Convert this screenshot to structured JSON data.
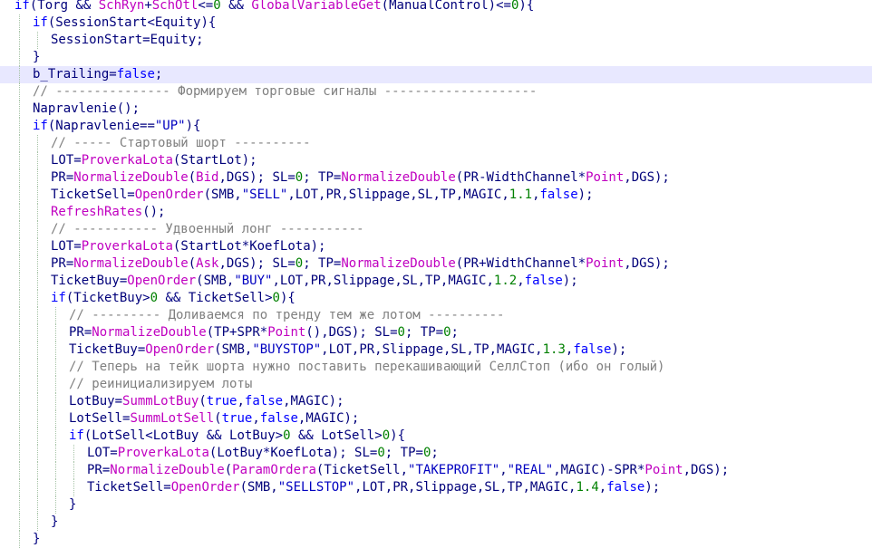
{
  "editor": {
    "colors": {
      "keyword": "#0000ff",
      "identifier": "#00007a",
      "function": "#c000c0",
      "string": "#0000c0",
      "number": "#008000",
      "comment": "#808080",
      "current_line": "#e8e8ff",
      "background": "#ffffff"
    },
    "lines": [
      {
        "indent": 0,
        "tokens": [
          [
            "kw",
            "if"
          ],
          [
            "id",
            "(Torg "
          ],
          [
            "op",
            "&& "
          ],
          [
            "fn",
            "SchRyn"
          ],
          [
            "op",
            "+"
          ],
          [
            "fn",
            "SchOtl"
          ],
          [
            "op",
            "<="
          ],
          [
            "num",
            "0"
          ],
          [
            "id",
            " "
          ],
          [
            "op",
            "&& "
          ],
          [
            "fn",
            "GlobalVariableGet"
          ],
          [
            "id",
            "(ManualControl)"
          ],
          [
            "op",
            "<="
          ],
          [
            "num",
            "0"
          ],
          [
            "id",
            ")"
          ],
          [
            "op",
            "{"
          ]
        ]
      },
      {
        "indent": 1,
        "tokens": [
          [
            "kw",
            "if"
          ],
          [
            "id",
            "(SessionStart"
          ],
          [
            "op",
            "<"
          ],
          [
            "id",
            "Equity)"
          ],
          [
            "op",
            "{"
          ]
        ]
      },
      {
        "indent": 2,
        "tokens": [
          [
            "id",
            "SessionStart"
          ],
          [
            "op",
            "="
          ],
          [
            "id",
            "Equity;"
          ]
        ]
      },
      {
        "indent": 1,
        "tokens": [
          [
            "op",
            "}"
          ]
        ]
      },
      {
        "indent": 1,
        "highlight": true,
        "tokens": [
          [
            "id",
            "b_Trailing"
          ],
          [
            "op",
            "="
          ],
          [
            "kw",
            "false"
          ],
          [
            "id",
            ";"
          ]
        ]
      },
      {
        "indent": 1,
        "tokens": [
          [
            "cm",
            "// --------------- Формируем торговые сигналы --------------------"
          ]
        ]
      },
      {
        "indent": 1,
        "tokens": [
          [
            "id",
            "Napravlenie();"
          ]
        ]
      },
      {
        "indent": 1,
        "tokens": [
          [
            "kw",
            "if"
          ],
          [
            "id",
            "(Napravlenie"
          ],
          [
            "op",
            "=="
          ],
          [
            "str",
            "\"UP\""
          ],
          [
            "id",
            ")"
          ],
          [
            "op",
            "{"
          ]
        ]
      },
      {
        "indent": 2,
        "tokens": [
          [
            "cm",
            "// ----- Стартовый шорт ----------"
          ]
        ]
      },
      {
        "indent": 2,
        "tokens": [
          [
            "id",
            "LOT"
          ],
          [
            "op",
            "="
          ],
          [
            "fn",
            "ProverkaLota"
          ],
          [
            "id",
            "(StartLot);"
          ]
        ]
      },
      {
        "indent": 2,
        "tokens": [
          [
            "id",
            "PR"
          ],
          [
            "op",
            "="
          ],
          [
            "fn",
            "NormalizeDouble"
          ],
          [
            "id",
            "("
          ],
          [
            "fn",
            "Bid"
          ],
          [
            "id",
            ",DGS); SL"
          ],
          [
            "op",
            "="
          ],
          [
            "num",
            "0"
          ],
          [
            "id",
            "; TP"
          ],
          [
            "op",
            "="
          ],
          [
            "fn",
            "NormalizeDouble"
          ],
          [
            "id",
            "(PR"
          ],
          [
            "op",
            "-"
          ],
          [
            "id",
            "WidthChannel"
          ],
          [
            "op",
            "*"
          ],
          [
            "fn",
            "Point"
          ],
          [
            "id",
            ",DGS);"
          ]
        ]
      },
      {
        "indent": 2,
        "tokens": [
          [
            "id",
            "TicketSell"
          ],
          [
            "op",
            "="
          ],
          [
            "fn",
            "OpenOrder"
          ],
          [
            "id",
            "(SMB,"
          ],
          [
            "str",
            "\"SELL\""
          ],
          [
            "id",
            ",LOT,PR,Slippage,SL,TP,MAGIC,"
          ],
          [
            "num",
            "1.1"
          ],
          [
            "id",
            ","
          ],
          [
            "kw",
            "false"
          ],
          [
            "id",
            ");"
          ]
        ]
      },
      {
        "indent": 2,
        "tokens": [
          [
            "fn",
            "RefreshRates"
          ],
          [
            "id",
            "();"
          ]
        ]
      },
      {
        "indent": 2,
        "tokens": [
          [
            "cm",
            "// ----------- Удвоенный лонг -----------"
          ]
        ]
      },
      {
        "indent": 2,
        "tokens": [
          [
            "id",
            "LOT"
          ],
          [
            "op",
            "="
          ],
          [
            "fn",
            "ProverkaLota"
          ],
          [
            "id",
            "(StartLot"
          ],
          [
            "op",
            "*"
          ],
          [
            "id",
            "KoefLota);"
          ]
        ]
      },
      {
        "indent": 2,
        "tokens": [
          [
            "id",
            "PR"
          ],
          [
            "op",
            "="
          ],
          [
            "fn",
            "NormalizeDouble"
          ],
          [
            "id",
            "("
          ],
          [
            "fn",
            "Ask"
          ],
          [
            "id",
            ",DGS); SL"
          ],
          [
            "op",
            "="
          ],
          [
            "num",
            "0"
          ],
          [
            "id",
            "; TP"
          ],
          [
            "op",
            "="
          ],
          [
            "fn",
            "NormalizeDouble"
          ],
          [
            "id",
            "(PR"
          ],
          [
            "op",
            "+"
          ],
          [
            "id",
            "WidthChannel"
          ],
          [
            "op",
            "*"
          ],
          [
            "fn",
            "Point"
          ],
          [
            "id",
            ",DGS);"
          ]
        ]
      },
      {
        "indent": 2,
        "tokens": [
          [
            "id",
            "TicketBuy"
          ],
          [
            "op",
            "="
          ],
          [
            "fn",
            "OpenOrder"
          ],
          [
            "id",
            "(SMB,"
          ],
          [
            "str",
            "\"BUY\""
          ],
          [
            "id",
            ",LOT,PR,Slippage,SL,TP,MAGIC,"
          ],
          [
            "num",
            "1.2"
          ],
          [
            "id",
            ","
          ],
          [
            "kw",
            "false"
          ],
          [
            "id",
            ");"
          ]
        ]
      },
      {
        "indent": 2,
        "tokens": [
          [
            "kw",
            "if"
          ],
          [
            "id",
            "(TicketBuy"
          ],
          [
            "op",
            ">"
          ],
          [
            "num",
            "0"
          ],
          [
            "id",
            " "
          ],
          [
            "op",
            "&& "
          ],
          [
            "id",
            "TicketSell"
          ],
          [
            "op",
            ">"
          ],
          [
            "num",
            "0"
          ],
          [
            "id",
            ")"
          ],
          [
            "op",
            "{"
          ]
        ]
      },
      {
        "indent": 3,
        "tokens": [
          [
            "cm",
            "// --------- Доливаемся по тренду тем же лотом ----------"
          ]
        ]
      },
      {
        "indent": 3,
        "tokens": [
          [
            "id",
            "PR"
          ],
          [
            "op",
            "="
          ],
          [
            "fn",
            "NormalizeDouble"
          ],
          [
            "id",
            "(TP"
          ],
          [
            "op",
            "+"
          ],
          [
            "id",
            "SPR"
          ],
          [
            "op",
            "*"
          ],
          [
            "fn",
            "Point"
          ],
          [
            "id",
            "(),DGS); SL"
          ],
          [
            "op",
            "="
          ],
          [
            "num",
            "0"
          ],
          [
            "id",
            "; TP"
          ],
          [
            "op",
            "="
          ],
          [
            "num",
            "0"
          ],
          [
            "id",
            ";"
          ]
        ]
      },
      {
        "indent": 3,
        "tokens": [
          [
            "id",
            "TicketBuy"
          ],
          [
            "op",
            "="
          ],
          [
            "fn",
            "OpenOrder"
          ],
          [
            "id",
            "(SMB,"
          ],
          [
            "str",
            "\"BUYSTOP\""
          ],
          [
            "id",
            ",LOT,PR,Slippage,SL,TP,MAGIC,"
          ],
          [
            "num",
            "1.3"
          ],
          [
            "id",
            ","
          ],
          [
            "kw",
            "false"
          ],
          [
            "id",
            ");"
          ]
        ]
      },
      {
        "indent": 3,
        "tokens": [
          [
            "cm",
            "// Теперь на тейк шорта нужно поставить перекашивающий СеллСтоп (ибо он голый)"
          ]
        ]
      },
      {
        "indent": 3,
        "tokens": [
          [
            "cm",
            "// реинициализируем лоты"
          ]
        ]
      },
      {
        "indent": 3,
        "tokens": [
          [
            "id",
            "LotBuy"
          ],
          [
            "op",
            "="
          ],
          [
            "fn",
            "SummLotBuy"
          ],
          [
            "id",
            "("
          ],
          [
            "kw",
            "true"
          ],
          [
            "id",
            ","
          ],
          [
            "kw",
            "false"
          ],
          [
            "id",
            ",MAGIC);"
          ]
        ]
      },
      {
        "indent": 3,
        "tokens": [
          [
            "id",
            "LotSell"
          ],
          [
            "op",
            "="
          ],
          [
            "fn",
            "SummLotSell"
          ],
          [
            "id",
            "("
          ],
          [
            "kw",
            "true"
          ],
          [
            "id",
            ","
          ],
          [
            "kw",
            "false"
          ],
          [
            "id",
            ",MAGIC);"
          ]
        ]
      },
      {
        "indent": 3,
        "tokens": [
          [
            "kw",
            "if"
          ],
          [
            "id",
            "(LotSell"
          ],
          [
            "op",
            "<"
          ],
          [
            "id",
            "LotBuy "
          ],
          [
            "op",
            "&& "
          ],
          [
            "id",
            "LotBuy"
          ],
          [
            "op",
            ">"
          ],
          [
            "num",
            "0"
          ],
          [
            "id",
            " "
          ],
          [
            "op",
            "&& "
          ],
          [
            "id",
            "LotSell"
          ],
          [
            "op",
            ">"
          ],
          [
            "num",
            "0"
          ],
          [
            "id",
            ")"
          ],
          [
            "op",
            "{"
          ]
        ]
      },
      {
        "indent": 4,
        "tokens": [
          [
            "id",
            "LOT"
          ],
          [
            "op",
            "="
          ],
          [
            "fn",
            "ProverkaLota"
          ],
          [
            "id",
            "(LotBuy"
          ],
          [
            "op",
            "*"
          ],
          [
            "id",
            "KoefLota); SL"
          ],
          [
            "op",
            "="
          ],
          [
            "num",
            "0"
          ],
          [
            "id",
            "; TP"
          ],
          [
            "op",
            "="
          ],
          [
            "num",
            "0"
          ],
          [
            "id",
            ";"
          ]
        ]
      },
      {
        "indent": 4,
        "tokens": [
          [
            "id",
            "PR"
          ],
          [
            "op",
            "="
          ],
          [
            "fn",
            "NormalizeDouble"
          ],
          [
            "id",
            "("
          ],
          [
            "fn",
            "ParamOrdera"
          ],
          [
            "id",
            "(TicketSell,"
          ],
          [
            "str",
            "\"TAKEPROFIT\""
          ],
          [
            "id",
            ","
          ],
          [
            "str",
            "\"REAL\""
          ],
          [
            "id",
            ",MAGIC)"
          ],
          [
            "op",
            "-"
          ],
          [
            "id",
            "SPR"
          ],
          [
            "op",
            "*"
          ],
          [
            "fn",
            "Point"
          ],
          [
            "id",
            ",DGS);"
          ]
        ]
      },
      {
        "indent": 4,
        "tokens": [
          [
            "id",
            "TicketSell"
          ],
          [
            "op",
            "="
          ],
          [
            "fn",
            "OpenOrder"
          ],
          [
            "id",
            "(SMB,"
          ],
          [
            "str",
            "\"SELLSTOP\""
          ],
          [
            "id",
            ",LOT,PR,Slippage,SL,TP,MAGIC,"
          ],
          [
            "num",
            "1.4"
          ],
          [
            "id",
            ","
          ],
          [
            "kw",
            "false"
          ],
          [
            "id",
            ");"
          ]
        ]
      },
      {
        "indent": 3,
        "tokens": [
          [
            "op",
            "}"
          ]
        ]
      },
      {
        "indent": 2,
        "tokens": [
          [
            "op",
            "}"
          ]
        ]
      },
      {
        "indent": 1,
        "tokens": [
          [
            "op",
            "}"
          ]
        ]
      }
    ]
  }
}
